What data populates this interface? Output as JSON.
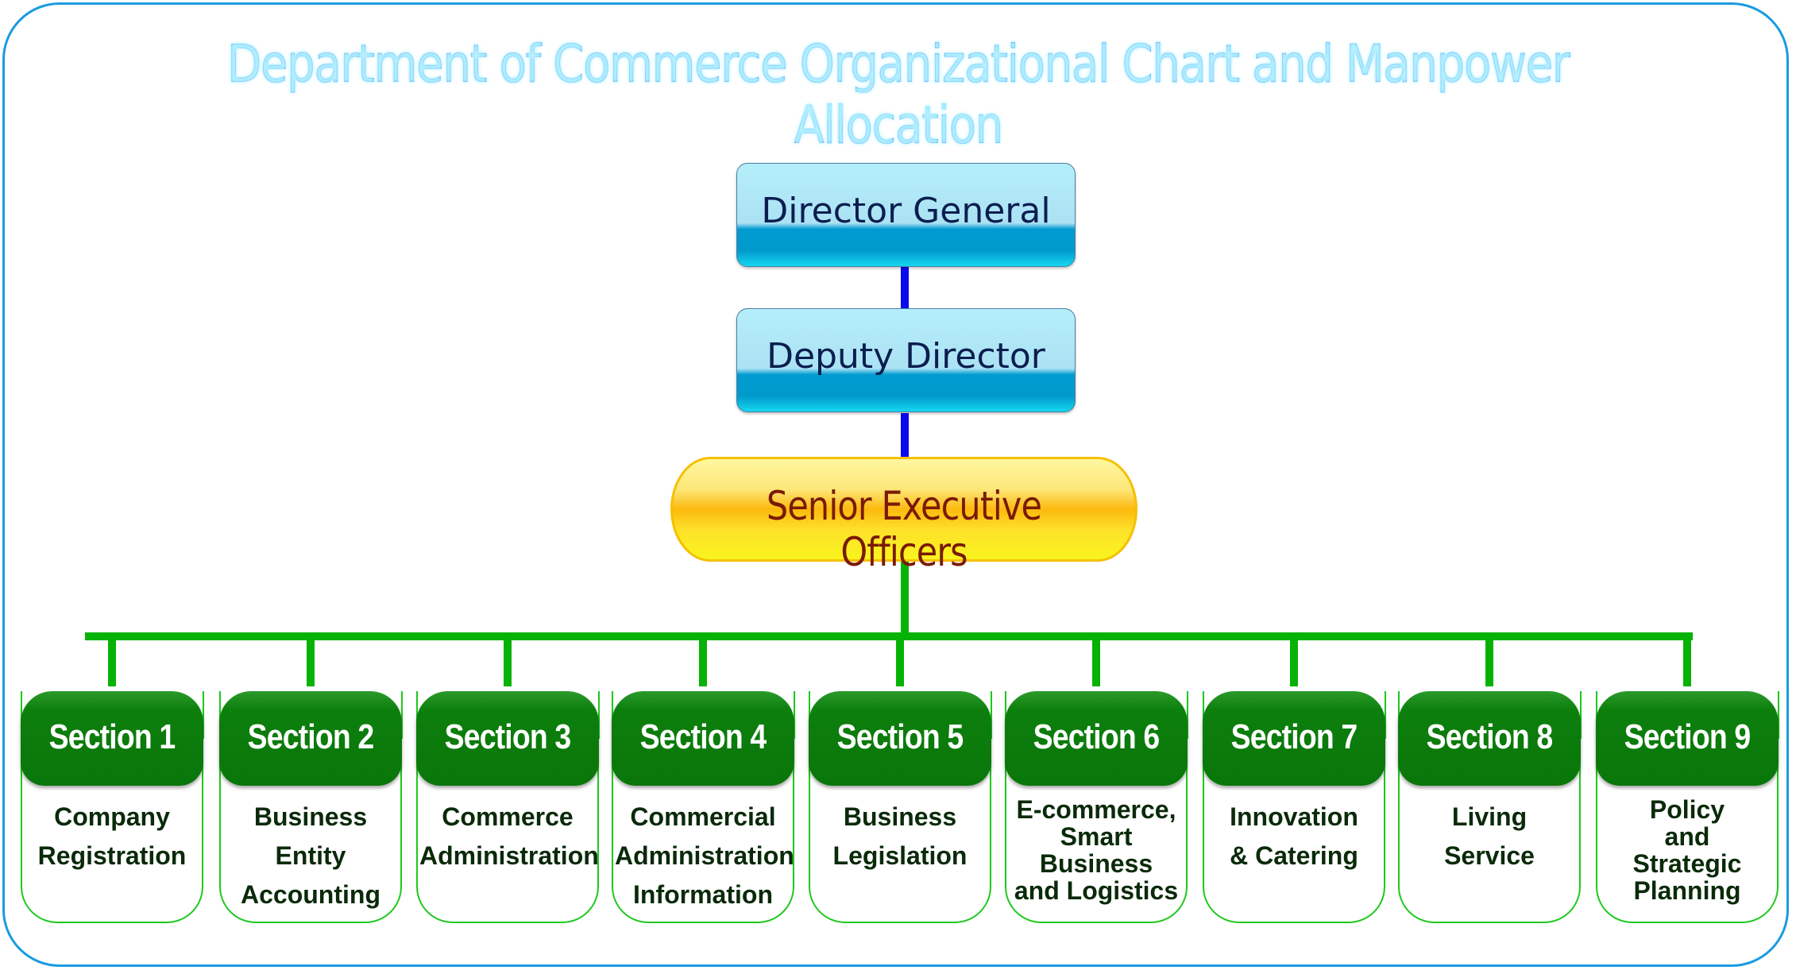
{
  "title": "Department of Commerce Organizational Chart and Manpower Allocation",
  "colors": {
    "frame": "#1a9be0",
    "title": "#1c3fe6",
    "executive_connector": "#0a0af0",
    "section_connector": "#07b207",
    "section_header": "#097609",
    "section_border": "#1ec81e",
    "senior_officers_text": "#7a1a05"
  },
  "nodes": {
    "director_general": "Director General",
    "deputy_director": "Deputy Director",
    "senior_executive_officers": "Senior Executive Officers"
  },
  "sections": [
    {
      "label": "Section 1",
      "lines": [
        "Company",
        "Registration"
      ]
    },
    {
      "label": "Section 2",
      "lines": [
        "Business",
        "Entity",
        "Accounting"
      ]
    },
    {
      "label": "Section 3",
      "lines": [
        "Commerce",
        "Administration"
      ]
    },
    {
      "label": "Section 4",
      "lines": [
        "Commercial",
        "Administration",
        "Information"
      ]
    },
    {
      "label": "Section 5",
      "lines": [
        "Business",
        "Legislation"
      ]
    },
    {
      "label": "Section 6",
      "lines": [
        "E-commerce,",
        "Smart",
        "Business",
        "and Logistics"
      ]
    },
    {
      "label": "Section 7",
      "lines": [
        "Innovation",
        "& Catering"
      ]
    },
    {
      "label": "Section 8",
      "lines": [
        "Living",
        "Service"
      ]
    },
    {
      "label": "Section 9",
      "lines": [
        "Policy",
        "and",
        "Strategic",
        "Planning"
      ]
    }
  ]
}
